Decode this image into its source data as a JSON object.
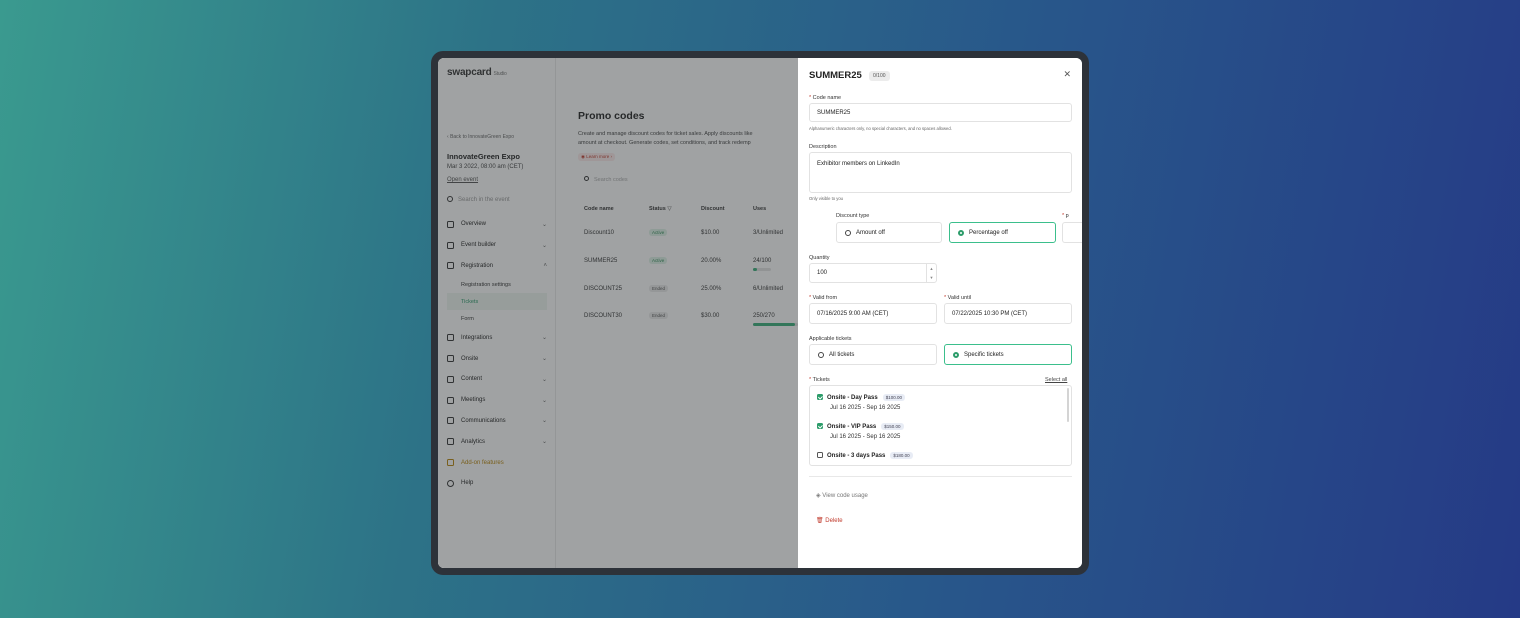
{
  "app": {
    "brand": "swapcard",
    "brand_sub": "Studio",
    "back_label": "Back to InnovateGreen Expo",
    "event_name": "InnovateGreen Expo",
    "event_date": "Mar 3 2022, 08:00 am (CET)",
    "open_event": "Open event",
    "search_placeholder": "Search in the event",
    "nav": [
      {
        "label": "Overview",
        "icon": "home-icon"
      },
      {
        "label": "Event builder",
        "icon": "builder-icon"
      },
      {
        "label": "Registration",
        "icon": "ticket-icon"
      },
      {
        "label": "Integrations",
        "icon": "plug-icon"
      },
      {
        "label": "Onsite",
        "icon": "badge-icon"
      },
      {
        "label": "Content",
        "icon": "layers-icon"
      },
      {
        "label": "Meetings",
        "icon": "meeting-icon"
      },
      {
        "label": "Communications",
        "icon": "chat-icon"
      },
      {
        "label": "Analytics",
        "icon": "chart-icon"
      },
      {
        "label": "Add-on features",
        "icon": "trophy-icon"
      },
      {
        "label": "Help",
        "icon": "help-icon"
      }
    ],
    "registration_sub": [
      "Registration settings",
      "Tickets",
      "Form"
    ],
    "page_title": "Promo codes",
    "page_desc_1": "Create and manage discount codes for ticket sales. Apply discounts like",
    "page_desc_2": "amount at checkout. Generate codes, set conditions, and track redemp",
    "learn_more": "Learn more",
    "table_search": "Search codes",
    "columns": {
      "code": "Code name",
      "status": "Status",
      "discount": "Discount",
      "uses": "Uses"
    },
    "rows": [
      {
        "code": "Discount10",
        "status": "Active",
        "discount": "$10.00",
        "uses": "3/Unlimited",
        "usage": null
      },
      {
        "code": "SUMMER25",
        "status": "Active",
        "discount": "20.00%",
        "uses": "24/100",
        "usage": 0.24
      },
      {
        "code": "DISCOUNT25",
        "status": "Ended",
        "discount": "25.00%",
        "uses": "6/Unlimited",
        "usage": null
      },
      {
        "code": "DISCOUNT30",
        "status": "Ended",
        "discount": "$30.00",
        "uses": "250/270",
        "usage": 0.93
      }
    ]
  },
  "drawer": {
    "title": "SUMMER25",
    "count": "0/100",
    "code_name_label": "Code name",
    "code_name_value": "SUMMER25",
    "code_name_hint": "Alphanumeric characters only, no special characters, and no spaces allowed.",
    "description_label": "Description",
    "description_value": "Exhibitor members on LinkedIn",
    "description_hint": "Only visible to you",
    "discount_type_label": "Discount type",
    "amount_off": "Amount off",
    "percentage_off": "Percentage off",
    "quantity_label": "Quantity",
    "quantity_value": "100",
    "valid_from_label": "Valid from",
    "valid_from_value": "07/16/2025 9:00 AM (CET)",
    "valid_until_label": "Valid until",
    "valid_until_value": "07/22/2025 10:30 PM (CET)",
    "applicable_label": "Applicable tickets",
    "all_tickets": "All tickets",
    "specific_tickets": "Specific tickets",
    "tickets_label": "Tickets",
    "select_all": "Select all",
    "tickets": [
      {
        "name": "Onsite - Day Pass",
        "price": "$100.00",
        "dates": "Jul 16 2025 - Sep 16 2025",
        "checked": true
      },
      {
        "name": "Onsite - VIP Pass",
        "price": "$150.00",
        "dates": "Jul 16 2025 - Sep 16 2025",
        "checked": true
      },
      {
        "name": "Onsite - 3 days Pass",
        "price": "$180.00",
        "dates": "",
        "checked": false
      }
    ],
    "view_usage": "View code usage",
    "delete": "Delete"
  },
  "colors": {
    "accent": "#2c9c6a",
    "danger": "#c0392b"
  }
}
